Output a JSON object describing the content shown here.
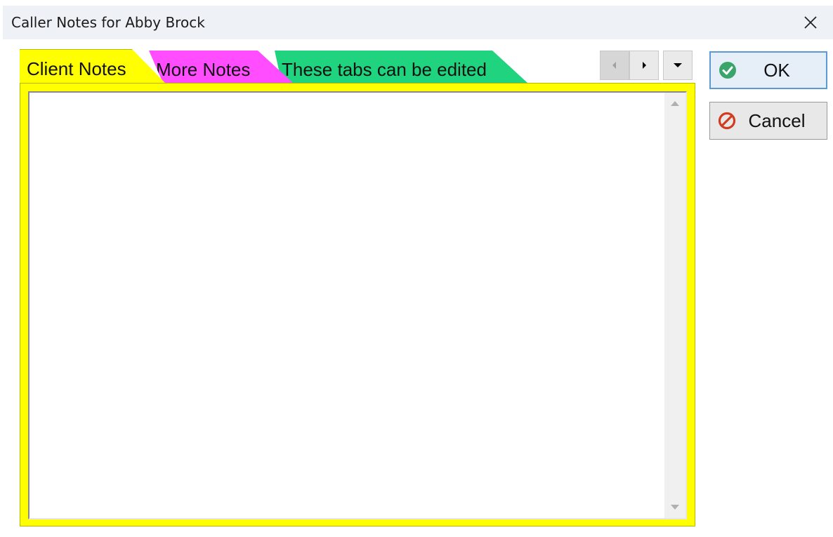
{
  "window": {
    "title": "Caller Notes for Abby Brock",
    "close_icon": "close-icon"
  },
  "tabs": [
    {
      "label": "Client Notes",
      "color": "#ffff00",
      "active": true
    },
    {
      "label": "More Notes",
      "color": "#ff4dff",
      "active": false
    },
    {
      "label": "These tabs can be edited",
      "color": "#1fd37f",
      "active": false
    }
  ],
  "tab_navigation": {
    "prev_icon": "chevron-left-icon",
    "next_icon": "chevron-right-icon",
    "menu_icon": "chevron-down-icon",
    "prev_enabled": false
  },
  "notes": {
    "text": ""
  },
  "buttons": {
    "ok_label": "OK",
    "ok_icon": "check-circle-icon",
    "ok_icon_color": "#3aa56b",
    "cancel_label": "Cancel",
    "cancel_icon": "no-entry-icon",
    "cancel_icon_color": "#d13c1f"
  }
}
